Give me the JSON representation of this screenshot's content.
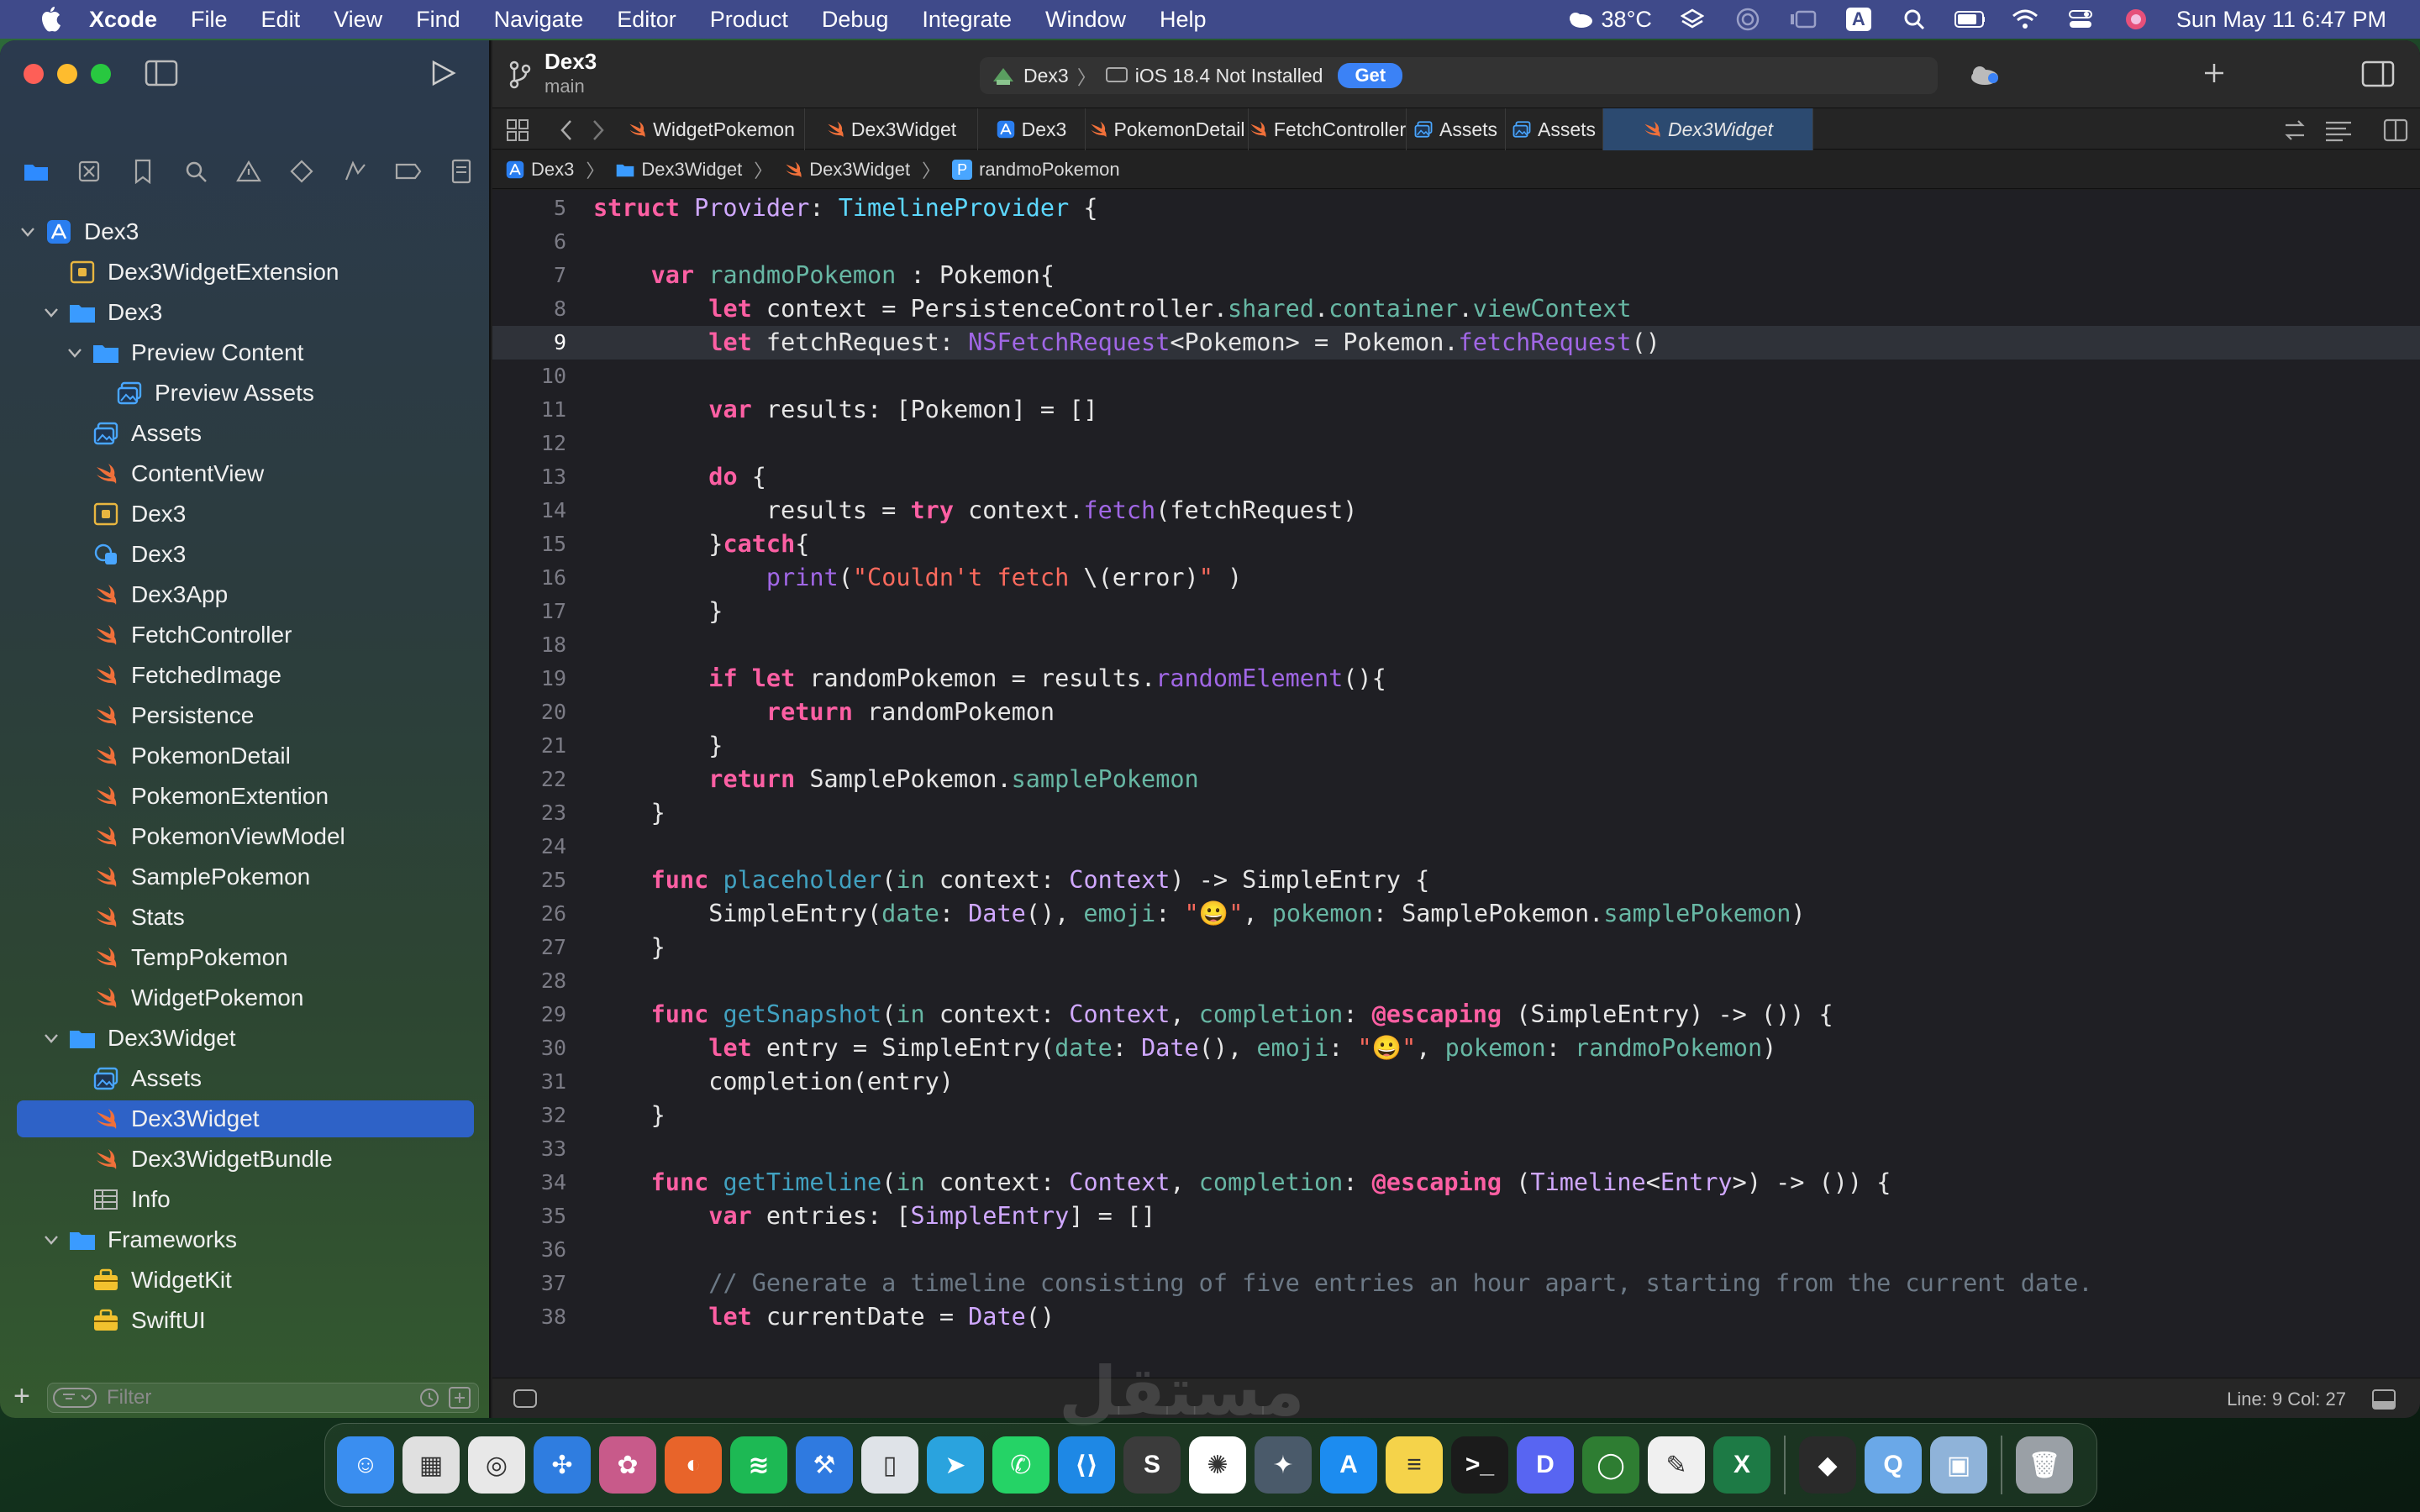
{
  "menubar": {
    "app_name": "Xcode",
    "menus": [
      "File",
      "Edit",
      "View",
      "Find",
      "Navigate",
      "Editor",
      "Product",
      "Debug",
      "Integrate",
      "Window",
      "Help"
    ],
    "weather": "38°C",
    "input_source": "A",
    "clock": "Sun May 11  6:47 PM"
  },
  "window": {
    "project_title": "Dex3",
    "branch": "main",
    "scheme": {
      "target": "Dex3",
      "destination": "iOS 18.4 Not Installed",
      "get_label": "Get"
    }
  },
  "tabs": [
    {
      "label": "WidgetPokemon",
      "icon": "swift-icon",
      "active": false
    },
    {
      "label": "Dex3Widget",
      "icon": "swift-icon",
      "active": false
    },
    {
      "label": "Dex3",
      "icon": "app-icon",
      "active": false
    },
    {
      "label": "PokemonDetail",
      "icon": "swift-icon",
      "active": false
    },
    {
      "label": "FetchController",
      "icon": "swift-icon",
      "active": false
    },
    {
      "label": "Assets",
      "icon": "assets-icon",
      "active": false
    },
    {
      "label": "Assets",
      "icon": "assets-icon",
      "active": false
    },
    {
      "label": "Dex3Widget",
      "icon": "swift-icon",
      "active": true
    }
  ],
  "breadcrumb": [
    "Dex3",
    "Dex3Widget",
    "Dex3Widget",
    "randmoPokemon"
  ],
  "breadcrumb_badge": "P",
  "navigator": {
    "items": [
      {
        "label": "Dex3",
        "icon": "app-icon",
        "depth": 0,
        "chevron": "down"
      },
      {
        "label": "Dex3WidgetExtension",
        "icon": "extension-icon",
        "depth": 1,
        "chevron": ""
      },
      {
        "label": "Dex3",
        "icon": "folder-icon",
        "depth": 1,
        "chevron": "down"
      },
      {
        "label": "Preview Content",
        "icon": "folder-icon",
        "depth": 2,
        "chevron": "down"
      },
      {
        "label": "Preview Assets",
        "icon": "assets-icon",
        "depth": 3,
        "chevron": ""
      },
      {
        "label": "Assets",
        "icon": "assets-icon",
        "depth": 2,
        "chevron": ""
      },
      {
        "label": "ContentView",
        "icon": "swift-icon",
        "depth": 2,
        "chevron": ""
      },
      {
        "label": "Dex3",
        "icon": "extension-icon",
        "depth": 2,
        "chevron": ""
      },
      {
        "label": "Dex3",
        "icon": "datamodel-icon",
        "depth": 2,
        "chevron": ""
      },
      {
        "label": "Dex3App",
        "icon": "swift-icon",
        "depth": 2,
        "chevron": ""
      },
      {
        "label": "FetchController",
        "icon": "swift-icon",
        "depth": 2,
        "chevron": ""
      },
      {
        "label": "FetchedImage",
        "icon": "swift-icon",
        "depth": 2,
        "chevron": ""
      },
      {
        "label": "Persistence",
        "icon": "swift-icon",
        "depth": 2,
        "chevron": ""
      },
      {
        "label": "PokemonDetail",
        "icon": "swift-icon",
        "depth": 2,
        "chevron": ""
      },
      {
        "label": "PokemonExtention",
        "icon": "swift-icon",
        "depth": 2,
        "chevron": ""
      },
      {
        "label": "PokemonViewModel",
        "icon": "swift-icon",
        "depth": 2,
        "chevron": ""
      },
      {
        "label": "SamplePokemon",
        "icon": "swift-icon",
        "depth": 2,
        "chevron": ""
      },
      {
        "label": "Stats",
        "icon": "swift-icon",
        "depth": 2,
        "chevron": ""
      },
      {
        "label": "TempPokemon",
        "icon": "swift-icon",
        "depth": 2,
        "chevron": ""
      },
      {
        "label": "WidgetPokemon",
        "icon": "swift-icon",
        "depth": 2,
        "chevron": ""
      },
      {
        "label": "Dex3Widget",
        "icon": "folder-icon",
        "depth": 1,
        "chevron": "down"
      },
      {
        "label": "Assets",
        "icon": "assets-icon",
        "depth": 2,
        "chevron": ""
      },
      {
        "label": "Dex3Widget",
        "icon": "swift-icon",
        "depth": 2,
        "chevron": "",
        "selected": true
      },
      {
        "label": "Dex3WidgetBundle",
        "icon": "swift-icon",
        "depth": 2,
        "chevron": ""
      },
      {
        "label": "Info",
        "icon": "plist-icon",
        "depth": 2,
        "chevron": ""
      },
      {
        "label": "Frameworks",
        "icon": "folder-icon",
        "depth": 1,
        "chevron": "down"
      },
      {
        "label": "WidgetKit",
        "icon": "toolbox-icon",
        "depth": 2,
        "chevron": ""
      },
      {
        "label": "SwiftUI",
        "icon": "toolbox-icon",
        "depth": 2,
        "chevron": ""
      }
    ],
    "filter_placeholder": "Filter"
  },
  "editor": {
    "highlighted_line": 9,
    "lines": [
      {
        "n": "5",
        "t": [
          [
            "kw",
            "struct "
          ],
          [
            "ty",
            "Provider"
          ],
          [
            "",
            ": "
          ],
          [
            "tyd",
            "TimelineProvider"
          ],
          [
            "",
            " {"
          ]
        ]
      },
      {
        "n": "6",
        "t": []
      },
      {
        "n": "7",
        "t": [
          [
            "",
            "    "
          ],
          [
            "kw",
            "var "
          ],
          [
            "vr",
            "randmoPokemon"
          ],
          [
            "",
            " : Pokemon{"
          ]
        ]
      },
      {
        "n": "8",
        "t": [
          [
            "",
            "        "
          ],
          [
            "kw",
            "let "
          ],
          [
            "",
            "context = PersistenceController."
          ],
          [
            "vr",
            "shared"
          ],
          [
            "",
            "."
          ],
          [
            "vr",
            "container"
          ],
          [
            "",
            "."
          ],
          [
            "vr",
            "viewContext"
          ]
        ]
      },
      {
        "n": "9",
        "t": [
          [
            "",
            "        "
          ],
          [
            "kw",
            "let "
          ],
          [
            "",
            "fetchRequest: "
          ],
          [
            "mt",
            "NSFetchRequest"
          ],
          [
            "",
            "<Pokemon> = Pokemon."
          ],
          [
            "mt",
            "fetchRequest"
          ],
          [
            "",
            "()"
          ]
        ]
      },
      {
        "n": "10",
        "t": []
      },
      {
        "n": "11",
        "t": [
          [
            "",
            "        "
          ],
          [
            "kw",
            "var "
          ],
          [
            "",
            "results: [Pokemon] = []"
          ]
        ]
      },
      {
        "n": "12",
        "t": []
      },
      {
        "n": "13",
        "t": [
          [
            "",
            "        "
          ],
          [
            "kw",
            "do"
          ],
          [
            "",
            " {"
          ]
        ]
      },
      {
        "n": "14",
        "t": [
          [
            "",
            "            results = "
          ],
          [
            "kw",
            "try "
          ],
          [
            "",
            "context."
          ],
          [
            "mt",
            "fetch"
          ],
          [
            "",
            "(fetchRequest)"
          ]
        ]
      },
      {
        "n": "15",
        "t": [
          [
            "",
            "        }"
          ],
          [
            "kw",
            "catch"
          ],
          [
            "",
            "{"
          ]
        ]
      },
      {
        "n": "16",
        "t": [
          [
            "",
            "            "
          ],
          [
            "mt",
            "print"
          ],
          [
            "",
            "("
          ],
          [
            "str",
            "\"Couldn't fetch "
          ],
          [
            "",
            "\\(error)"
          ],
          [
            "str",
            "\""
          ],
          [
            "",
            " )"
          ]
        ]
      },
      {
        "n": "17",
        "t": [
          [
            "",
            "        }"
          ]
        ]
      },
      {
        "n": "18",
        "t": []
      },
      {
        "n": "19",
        "t": [
          [
            "",
            "        "
          ],
          [
            "kw",
            "if let "
          ],
          [
            "",
            "randomPokemon = results."
          ],
          [
            "mt",
            "randomElement"
          ],
          [
            "",
            "(){"
          ]
        ]
      },
      {
        "n": "20",
        "t": [
          [
            "",
            "            "
          ],
          [
            "kw",
            "return "
          ],
          [
            "",
            "randomPokemon"
          ]
        ]
      },
      {
        "n": "21",
        "t": [
          [
            "",
            "        }"
          ]
        ]
      },
      {
        "n": "22",
        "t": [
          [
            "",
            "        "
          ],
          [
            "kw",
            "return "
          ],
          [
            "",
            "SamplePokemon."
          ],
          [
            "vr",
            "samplePokemon"
          ]
        ]
      },
      {
        "n": "23",
        "t": [
          [
            "",
            "    }"
          ]
        ]
      },
      {
        "n": "24",
        "t": []
      },
      {
        "n": "25",
        "t": [
          [
            "",
            "    "
          ],
          [
            "kw",
            "func "
          ],
          [
            "fn",
            "placeholder"
          ],
          [
            "",
            "("
          ],
          [
            "vr",
            "in "
          ],
          [
            "",
            "context: "
          ],
          [
            "ty",
            "Context"
          ],
          [
            "",
            ") -> SimpleEntry {"
          ]
        ]
      },
      {
        "n": "26",
        "t": [
          [
            "",
            "        SimpleEntry("
          ],
          [
            "vr",
            "date"
          ],
          [
            "",
            ": "
          ],
          [
            "ty",
            "Date"
          ],
          [
            "",
            "(), "
          ],
          [
            "vr",
            "emoji"
          ],
          [
            "",
            ": "
          ],
          [
            "str",
            "\"😀\""
          ],
          [
            "",
            ", "
          ],
          [
            "vr",
            "pokemon"
          ],
          [
            "",
            ": SamplePokemon."
          ],
          [
            "vr",
            "samplePokemon"
          ],
          [
            "",
            ")"
          ]
        ]
      },
      {
        "n": "27",
        "t": [
          [
            "",
            "    }"
          ]
        ]
      },
      {
        "n": "28",
        "t": []
      },
      {
        "n": "29",
        "t": [
          [
            "",
            "    "
          ],
          [
            "kw",
            "func "
          ],
          [
            "fn",
            "getSnapshot"
          ],
          [
            "",
            "("
          ],
          [
            "vr",
            "in "
          ],
          [
            "",
            "context: "
          ],
          [
            "ty",
            "Context"
          ],
          [
            "",
            ", "
          ],
          [
            "vr",
            "completion"
          ],
          [
            "",
            ": "
          ],
          [
            "kw",
            "@escaping "
          ],
          [
            "",
            "(SimpleEntry) -> ()) {"
          ]
        ]
      },
      {
        "n": "30",
        "t": [
          [
            "",
            "        "
          ],
          [
            "kw",
            "let "
          ],
          [
            "",
            "entry = SimpleEntry("
          ],
          [
            "vr",
            "date"
          ],
          [
            "",
            ": "
          ],
          [
            "ty",
            "Date"
          ],
          [
            "",
            "(), "
          ],
          [
            "vr",
            "emoji"
          ],
          [
            "",
            ": "
          ],
          [
            "str",
            "\"😀\""
          ],
          [
            "",
            ", "
          ],
          [
            "vr",
            "pokemon"
          ],
          [
            "",
            ": "
          ],
          [
            "vr",
            "randmoPokemon"
          ],
          [
            "",
            ")"
          ]
        ]
      },
      {
        "n": "31",
        "t": [
          [
            "",
            "        completion(entry)"
          ]
        ]
      },
      {
        "n": "32",
        "t": [
          [
            "",
            "    }"
          ]
        ]
      },
      {
        "n": "33",
        "t": []
      },
      {
        "n": "34",
        "t": [
          [
            "",
            "    "
          ],
          [
            "kw",
            "func "
          ],
          [
            "fn",
            "getTimeline"
          ],
          [
            "",
            "("
          ],
          [
            "vr",
            "in "
          ],
          [
            "",
            "context: "
          ],
          [
            "ty",
            "Context"
          ],
          [
            "",
            ", "
          ],
          [
            "vr",
            "completion"
          ],
          [
            "",
            ": "
          ],
          [
            "kw",
            "@escaping "
          ],
          [
            "",
            "("
          ],
          [
            "ty",
            "Timeline"
          ],
          [
            "",
            "<"
          ],
          [
            "ty",
            "Entry"
          ],
          [
            "",
            ">) -> ()) {"
          ]
        ]
      },
      {
        "n": "35",
        "t": [
          [
            "",
            "        "
          ],
          [
            "kw",
            "var "
          ],
          [
            "",
            "entries: ["
          ],
          [
            "ty",
            "SimpleEntry"
          ],
          [
            "",
            "] = []"
          ]
        ]
      },
      {
        "n": "36",
        "t": []
      },
      {
        "n": "37",
        "t": [
          [
            "",
            "        "
          ],
          [
            "cm",
            "// Generate a timeline consisting of five entries an hour apart, starting from the current date."
          ]
        ]
      },
      {
        "n": "38",
        "t": [
          [
            "",
            "        "
          ],
          [
            "kw",
            "let "
          ],
          [
            "",
            "currentDate = "
          ],
          [
            "ty",
            "Date"
          ],
          [
            "",
            "()"
          ]
        ]
      }
    ]
  },
  "status": {
    "cursor": "Line: 9  Col: 27"
  },
  "dock": [
    {
      "name": "finder",
      "color": "#3a8ef0",
      "glyph": "☺"
    },
    {
      "name": "launchpad",
      "color": "#e0e0e0",
      "glyph": "▦"
    },
    {
      "name": "chrome",
      "color": "#e8e8e8",
      "glyph": "◎"
    },
    {
      "name": "safari",
      "color": "#2f7de0",
      "glyph": "✣"
    },
    {
      "name": "app-store-alt",
      "color": "#c85a8a",
      "glyph": "✿"
    },
    {
      "name": "firefox",
      "color": "#e8642a",
      "glyph": "◐"
    },
    {
      "name": "spotify",
      "color": "#1db954",
      "glyph": "≋"
    },
    {
      "name": "xcode",
      "color": "#2f7ae0",
      "glyph": "⚒"
    },
    {
      "name": "simulator",
      "color": "#dfe3e8",
      "glyph": "▯"
    },
    {
      "name": "telegram",
      "color": "#2aa3de",
      "glyph": "➤"
    },
    {
      "name": "whatsapp",
      "color": "#25d366",
      "glyph": "✆"
    },
    {
      "name": "vscode",
      "color": "#1e88e5",
      "glyph": "⟨⟩"
    },
    {
      "name": "sublime",
      "color": "#3b3b3b",
      "glyph": "S"
    },
    {
      "name": "chatgpt",
      "color": "#ffffff",
      "glyph": "✺"
    },
    {
      "name": "app-tool",
      "color": "#4a5a6a",
      "glyph": "✦"
    },
    {
      "name": "app-store",
      "color": "#1c8cf0",
      "glyph": "A"
    },
    {
      "name": "notes",
      "color": "#f5d34a",
      "glyph": "≡"
    },
    {
      "name": "terminal",
      "color": "#1b1b1b",
      "glyph": ">_"
    },
    {
      "name": "discord-like",
      "color": "#5865f2",
      "glyph": "D"
    },
    {
      "name": "activity",
      "color": "#2e7d32",
      "glyph": "◯"
    },
    {
      "name": "textedit",
      "color": "#f0f0f0",
      "glyph": "✎"
    },
    {
      "name": "excel",
      "color": "#1d7a45",
      "glyph": "X"
    },
    {
      "name": "cursor-app",
      "color": "#2a2a2a",
      "glyph": "◆"
    },
    {
      "name": "quicktime",
      "color": "#6aa8e8",
      "glyph": "Q"
    },
    {
      "name": "preview",
      "color": "#8fb3d9",
      "glyph": "▣"
    },
    {
      "name": "trash",
      "color": "#9aa0a6",
      "glyph": "🗑"
    }
  ],
  "watermark": "مستقل",
  "colors": {
    "menubar_bg": "#3f4a8a",
    "selection": "#2e62c7",
    "keyword": "#fc5fa3",
    "string": "#fc6a5d",
    "comment": "#6c7986"
  }
}
